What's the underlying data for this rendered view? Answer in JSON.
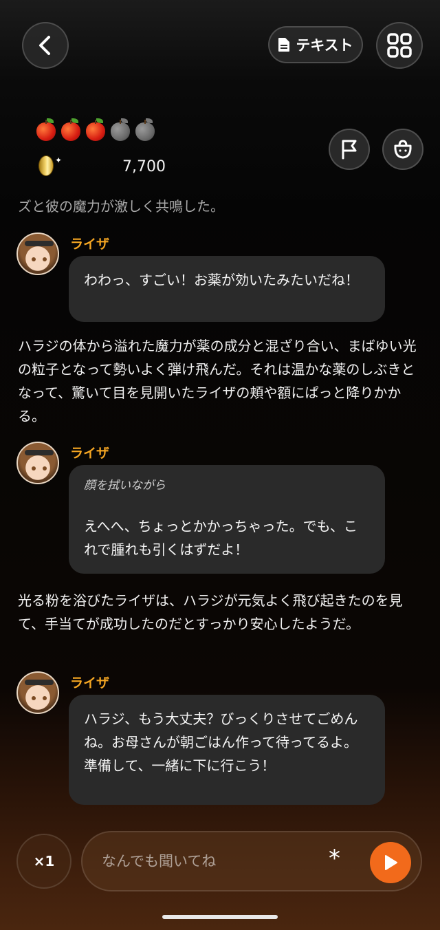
{
  "header": {
    "back_icon": "chevron-left-icon",
    "text_button_label": "テキスト",
    "text_button_icon": "document-icon",
    "menu_icon": "grid-icon"
  },
  "status": {
    "apples": [
      {
        "filled": true
      },
      {
        "filled": true
      },
      {
        "filled": true
      },
      {
        "filled": false
      },
      {
        "filled": false
      }
    ],
    "coins": "7,700",
    "flag_icon": "flag-icon",
    "bag_icon": "bag-icon"
  },
  "chat": {
    "partial_line": "ズと彼の魔力が激しく共鳴した。",
    "messages": [
      {
        "speaker": "ライザ",
        "text": "わわっ、すごい！お薬が効いたみたいだね！"
      },
      {
        "narration": "ハラジの体から溢れた魔力が薬の成分と混ざり合い、まばゆい光の粒子となって勢いよく弾け飛んだ。それは温かな薬のしぶきとなって、驚いて目を見開いたライザの頬や額にぱっと降りかかる。"
      },
      {
        "speaker": "ライザ",
        "action": "顔を拭いながら",
        "text": "えへへ、ちょっとかかっちゃった。でも、これで腫れも引くはずだよ！"
      },
      {
        "narration": "光る粉を浴びたライザは、ハラジが元気よく飛び起きたのを見て、手当てが成功したのだとすっかり安心したようだ。"
      },
      {
        "speaker": "ライザ",
        "text": "ハラジ、もう大丈夫？びっくりさせてごめんね。お母さんが朝ごはん作って待ってるよ。準備して、一緒に下に行こう！"
      }
    ]
  },
  "footer": {
    "speed_label": "×1",
    "input_placeholder": "なんでも聞いてね",
    "asterisk": "*",
    "send_icon": "play-icon"
  },
  "colors": {
    "accent": "#f26a1b",
    "speaker": "#f5a623",
    "bubble": "#2a2a2a"
  }
}
